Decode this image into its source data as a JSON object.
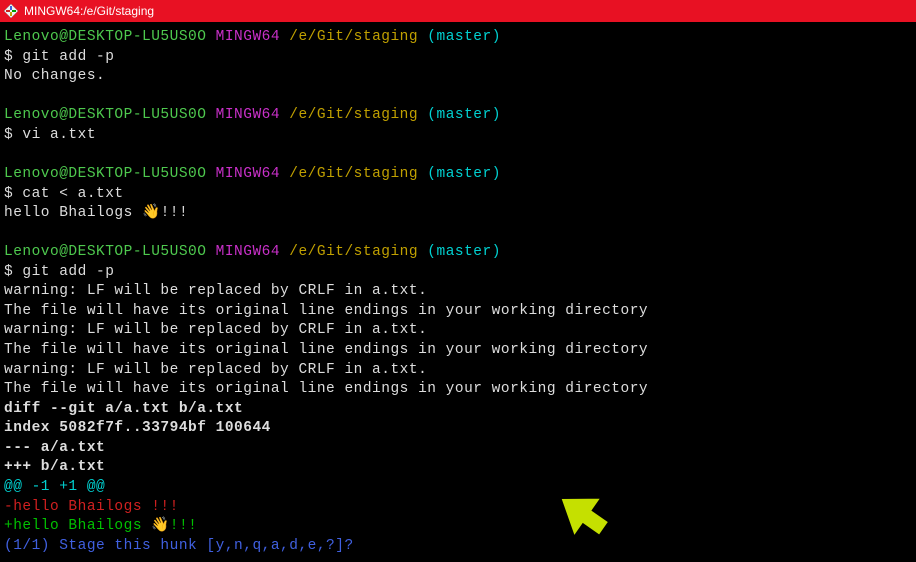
{
  "titlebar": {
    "title": "MINGW64:/e/Git/staging"
  },
  "prompt": {
    "user": "Lenovo@DESKTOP-LU5US0O",
    "mingw": "MINGW64",
    "path": "/e/Git/staging",
    "branch": "(master)"
  },
  "cmd": {
    "git_add_p_1": "$ git add -p",
    "no_changes": "No changes.",
    "vi": "$ vi a.txt",
    "cat": "$ cat < a.txt",
    "cat_output": "hello Bhailogs 👋!!!",
    "git_add_p_2": "$ git add -p",
    "warn1": "warning: LF will be replaced by CRLF in a.txt.",
    "warn2": "The file will have its original line endings in your working directory",
    "diff_header": "diff --git a/a.txt b/a.txt",
    "index_line": "index 5082f7f..33794bf 100644",
    "minus_file": "--- a/a.txt",
    "plus_file": "+++ b/a.txt",
    "hunk_header": "@@ -1 +1 @@",
    "removed_line": "-hello Bhailogs !!!",
    "added_line": "+hello Bhailogs 👋!!!",
    "stage_prompt": "(1/1) Stage this hunk [y,n,q,a,d,e,?]?"
  }
}
